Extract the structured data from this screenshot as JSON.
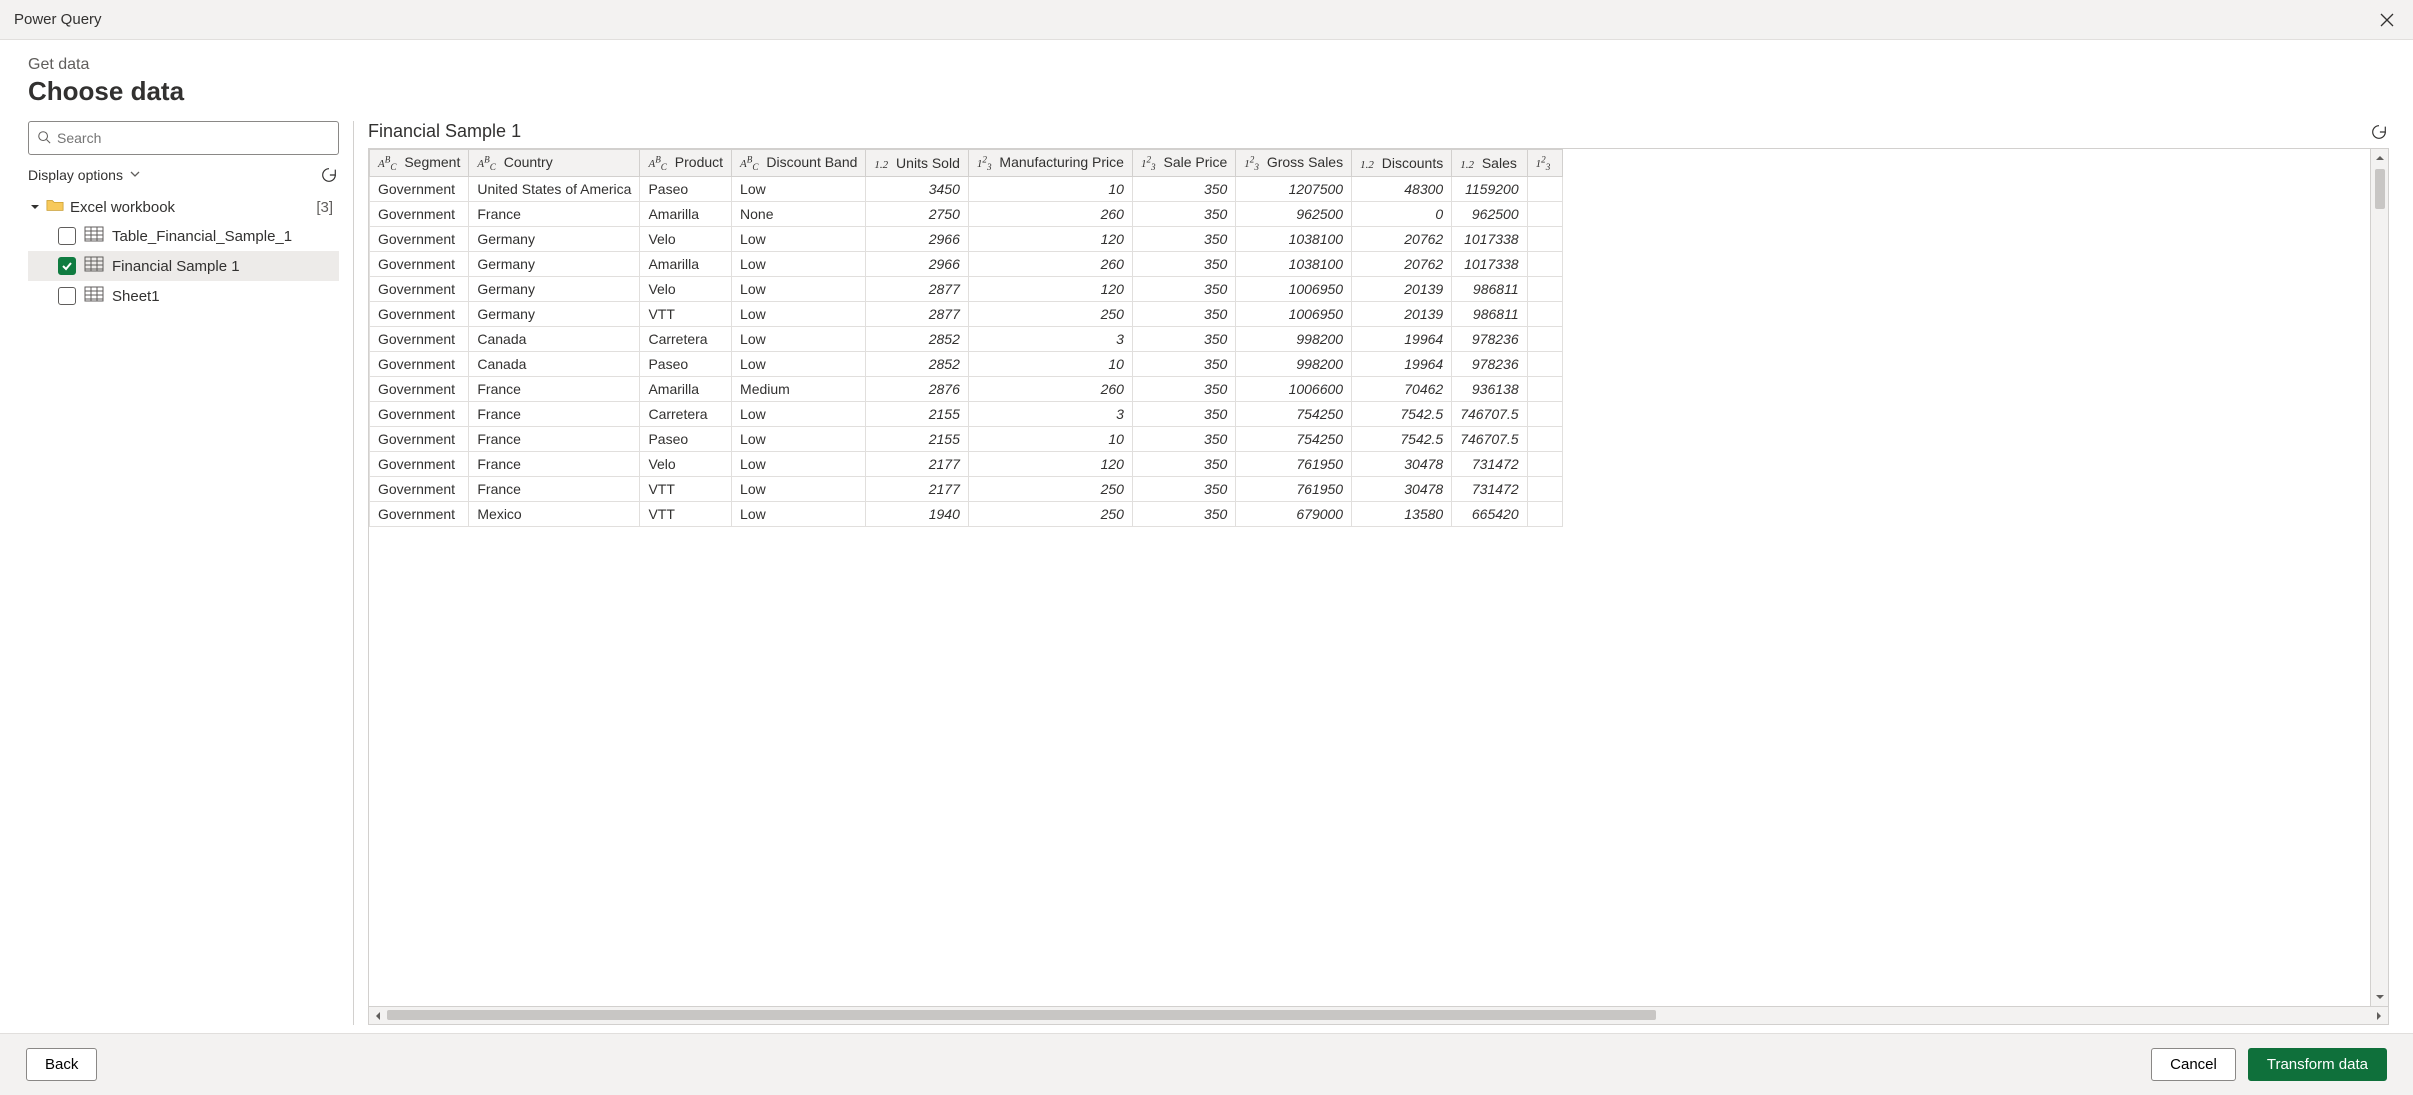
{
  "titlebar": {
    "title": "Power Query"
  },
  "header": {
    "breadcrumb": "Get data",
    "title": "Choose data"
  },
  "sidebar": {
    "search_placeholder": "Search",
    "display_options_label": "Display options",
    "root": {
      "label": "Excel workbook",
      "count": "[3]"
    },
    "items": [
      {
        "label": "Table_Financial_Sample_1",
        "checked": false,
        "selected": false
      },
      {
        "label": "Financial Sample 1",
        "checked": true,
        "selected": true
      },
      {
        "label": "Sheet1",
        "checked": false,
        "selected": false
      }
    ]
  },
  "preview": {
    "title": "Financial Sample 1",
    "columns": [
      {
        "type": "abc",
        "label": "Segment",
        "align": "left"
      },
      {
        "type": "abc",
        "label": "Country",
        "align": "left"
      },
      {
        "type": "abc",
        "label": "Product",
        "align": "left"
      },
      {
        "type": "abc",
        "label": "Discount Band",
        "align": "left"
      },
      {
        "type": "n12",
        "label": "Units Sold",
        "align": "right"
      },
      {
        "type": "n123",
        "label": "Manufacturing Price",
        "align": "right"
      },
      {
        "type": "n123",
        "label": "Sale Price",
        "align": "right"
      },
      {
        "type": "n123",
        "label": "Gross Sales",
        "align": "right"
      },
      {
        "type": "n12",
        "label": "Discounts",
        "align": "right"
      },
      {
        "type": "n12",
        "label": "Sales",
        "align": "right"
      },
      {
        "type": "n123",
        "label": "",
        "align": "right"
      }
    ],
    "rows": [
      [
        "Government",
        "United States of America",
        "Paseo",
        "Low",
        "3450",
        "10",
        "350",
        "1207500",
        "48300",
        "1159200"
      ],
      [
        "Government",
        "France",
        "Amarilla",
        "None",
        "2750",
        "260",
        "350",
        "962500",
        "0",
        "962500"
      ],
      [
        "Government",
        "Germany",
        "Velo",
        "Low",
        "2966",
        "120",
        "350",
        "1038100",
        "20762",
        "1017338"
      ],
      [
        "Government",
        "Germany",
        "Amarilla",
        "Low",
        "2966",
        "260",
        "350",
        "1038100",
        "20762",
        "1017338"
      ],
      [
        "Government",
        "Germany",
        "Velo",
        "Low",
        "2877",
        "120",
        "350",
        "1006950",
        "20139",
        "986811"
      ],
      [
        "Government",
        "Germany",
        "VTT",
        "Low",
        "2877",
        "250",
        "350",
        "1006950",
        "20139",
        "986811"
      ],
      [
        "Government",
        "Canada",
        "Carretera",
        "Low",
        "2852",
        "3",
        "350",
        "998200",
        "19964",
        "978236"
      ],
      [
        "Government",
        "Canada",
        "Paseo",
        "Low",
        "2852",
        "10",
        "350",
        "998200",
        "19964",
        "978236"
      ],
      [
        "Government",
        "France",
        "Amarilla",
        "Medium",
        "2876",
        "260",
        "350",
        "1006600",
        "70462",
        "936138"
      ],
      [
        "Government",
        "France",
        "Carretera",
        "Low",
        "2155",
        "3",
        "350",
        "754250",
        "7542.5",
        "746707.5"
      ],
      [
        "Government",
        "France",
        "Paseo",
        "Low",
        "2155",
        "10",
        "350",
        "754250",
        "7542.5",
        "746707.5"
      ],
      [
        "Government",
        "France",
        "Velo",
        "Low",
        "2177",
        "120",
        "350",
        "761950",
        "30478",
        "731472"
      ],
      [
        "Government",
        "France",
        "VTT",
        "Low",
        "2177",
        "250",
        "350",
        "761950",
        "30478",
        "731472"
      ],
      [
        "Government",
        "Mexico",
        "VTT",
        "Low",
        "1940",
        "250",
        "350",
        "679000",
        "13580",
        "665420"
      ]
    ]
  },
  "footer": {
    "back_label": "Back",
    "cancel_label": "Cancel",
    "transform_label": "Transform data"
  },
  "type_icons": {
    "abc": "A<sup>B</sup><sub>C</sub>",
    "n12": "1.2",
    "n123": "1<sup>2</sup><sub>3</sub>"
  }
}
